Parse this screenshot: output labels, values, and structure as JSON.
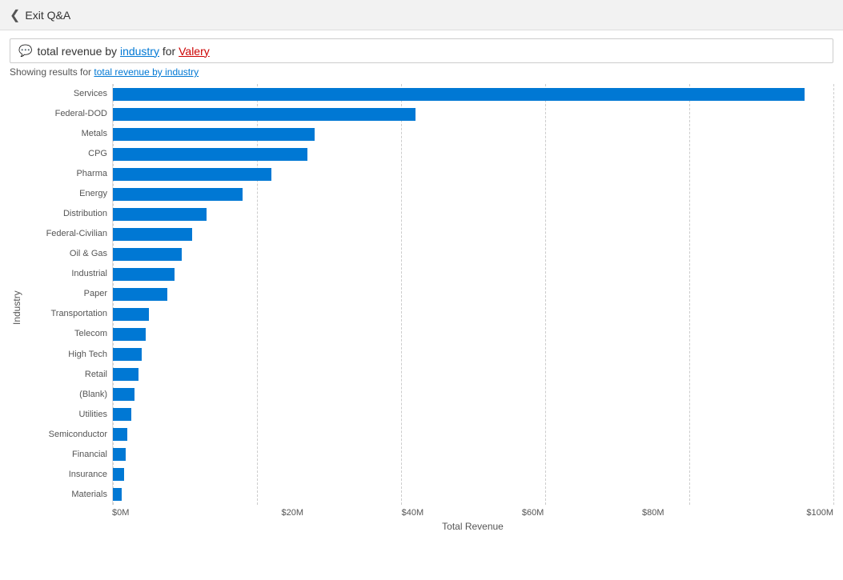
{
  "header": {
    "back_label": "Exit Q&A"
  },
  "search": {
    "query_prefix": "total revenue by ",
    "query_keyword1": "industry",
    "query_middle": " for ",
    "query_keyword2": "Valery"
  },
  "results_label": "Showing results for ",
  "results_link": "total revenue by industry",
  "chart": {
    "y_axis_label": "Industry",
    "x_axis_label": "Total Revenue",
    "x_ticks": [
      "$0M",
      "$20M",
      "$40M",
      "$60M",
      "$80M",
      "$100M"
    ],
    "max_value": 100,
    "bars": [
      {
        "label": "Services",
        "value": 96
      },
      {
        "label": "Federal-DOD",
        "value": 42
      },
      {
        "label": "Metals",
        "value": 28
      },
      {
        "label": "CPG",
        "value": 27
      },
      {
        "label": "Pharma",
        "value": 22
      },
      {
        "label": "Energy",
        "value": 18
      },
      {
        "label": "Distribution",
        "value": 13
      },
      {
        "label": "Federal-Civilian",
        "value": 11
      },
      {
        "label": "Oil & Gas",
        "value": 9.5
      },
      {
        "label": "Industrial",
        "value": 8.5
      },
      {
        "label": "Paper",
        "value": 7.5
      },
      {
        "label": "Transportation",
        "value": 5
      },
      {
        "label": "Telecom",
        "value": 4.5
      },
      {
        "label": "High Tech",
        "value": 4
      },
      {
        "label": "Retail",
        "value": 3.5
      },
      {
        "label": "(Blank)",
        "value": 3
      },
      {
        "label": "Utilities",
        "value": 2.5
      },
      {
        "label": "Semiconductor",
        "value": 2
      },
      {
        "label": "Financial",
        "value": 1.8
      },
      {
        "label": "Insurance",
        "value": 1.5
      },
      {
        "label": "Materials",
        "value": 1.2
      }
    ]
  }
}
